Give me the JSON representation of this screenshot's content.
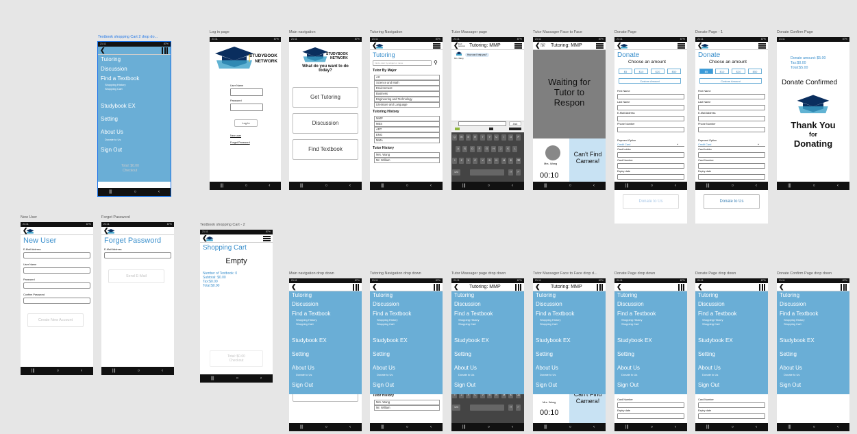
{
  "screens": {
    "cart2dd": {
      "label": "Textbook shopping Cart 2 drop do..."
    },
    "login": {
      "label": "Log in page",
      "brand1": "STUDYBOOK",
      "brand2": "NETWORK",
      "username_label": "User Name",
      "password_label": "Password",
      "login_btn": "Log In",
      "new_user": "New user",
      "forget_pw": "Forget Password"
    },
    "mainnav": {
      "label": "Main navigation",
      "question": "What do you want to do today?",
      "btn1": "Get Tutoring",
      "btn2": "Discussion",
      "btn3": "Find Textbook"
    },
    "tutnav": {
      "label": "Tutoring Navigation",
      "title": "Tutoring",
      "search_placeholder": "Find a tutor by subject or name",
      "major_header": "Tutor By Major",
      "majors": [
        "Art",
        "Science and Math",
        "Environment",
        "Business",
        "Engineering and Technology",
        "Literature and Language"
      ],
      "history_header": "Tutoring History",
      "history": [
        "MMP",
        "MES",
        "ART",
        "ENG",
        "MMA"
      ],
      "tutor_history_header": "Tutor History",
      "tutors": [
        "Mrs. Wang",
        "Mr. William"
      ]
    },
    "massager": {
      "label": "Tutor Massager page",
      "header_small1": "End",
      "header_small2": "session",
      "header_title": "Tutoring: MMP",
      "bubble": "How can I help you?",
      "ask": "Ask",
      "person": "Mrs. Wang"
    },
    "f2f": {
      "label": "Tutor Massager Face to Face",
      "header_title": "Tutoring: MMP",
      "waiting": "Waiting for Tutor to Respon",
      "camera": "Can't Find Camera!",
      "person": "Mrs. Wang",
      "timer": "00:10"
    },
    "donate": {
      "label": "Donate Page",
      "title": "Donate",
      "choose": "Choose an amount",
      "amounts": [
        "$5",
        "$10",
        "$20",
        "$50"
      ],
      "custom": "Custom Amount",
      "first": "First Name",
      "last": "Last Name",
      "email": "E-Mail Address",
      "phone": "Phone Number",
      "payment": "Payment Option",
      "credit": "Credit Card",
      "holder": "Card holder",
      "cardnum": "Card Number",
      "expiry": "Expiry date",
      "donate_btn": "Donate to Us"
    },
    "donate1": {
      "label": "Donate Page - 1"
    },
    "confirm": {
      "label": "Donate Confirm Page",
      "amount": "Donate amount: $5.00",
      "tax": "Tax:$0.00",
      "total": "Total:$5.00",
      "confirmed": "Donate Confirmed",
      "thank1": "Thank You",
      "thank2": "for",
      "thank3": "Donating"
    },
    "newuser": {
      "label": "New User",
      "title": "New User",
      "email": "E-Mail Address",
      "username": "User Name",
      "password": "Password",
      "confirm": "Confirm Password",
      "create": "Create New Account"
    },
    "forget": {
      "label": "Forget Password",
      "title": "Forget Password",
      "email": "E-Mail Address",
      "send": "Send E-Mail"
    },
    "cart2": {
      "label": "Textbook shopping Cart - 2",
      "title": "Shopping Cart",
      "empty": "Empty",
      "num": "Number of Textbook: 0",
      "subtotal": "Subtotal: $0.00",
      "tax": "Tax:$0.00",
      "total": "Total:$0.00",
      "checkout1": "Total: $0.00",
      "checkout2": "Checkout"
    },
    "mainnavdd": {
      "label": "Main navigation drop down"
    },
    "tutnavdd": {
      "label": "Tutoring Navigation  drop down"
    },
    "massagerdd": {
      "label": "Tutor Massager page drop down"
    },
    "f2fdd": {
      "label": "Tutor Massager Face to Face drop d..."
    },
    "donatedd": {
      "label": "Donate Page drop down"
    },
    "donatedd2": {
      "label": "Donate Page drop down"
    },
    "confirmdd": {
      "label": "Donate Confirm Page drop down"
    }
  },
  "menu": {
    "tutoring": "Tutoring",
    "discussion": "Discussion",
    "find": "Find a Textbook",
    "history": "Shopping History",
    "cart": "Shopping Cart",
    "studybook": "Studybook EX",
    "setting": "Setting",
    "about": "About Us",
    "donate": "Donate to Us",
    "signout": "Sign Out"
  },
  "status": {
    "time": "21:11",
    "battery": "87%"
  },
  "keyboard": {
    "row1": [
      "Q",
      "W",
      "E",
      "R",
      "T",
      "Y",
      "U",
      "I",
      "O",
      "P"
    ],
    "row2": [
      "A",
      "S",
      "D",
      "F",
      "G",
      "H",
      "J",
      "K",
      "L"
    ],
    "row3": [
      "⇧",
      "Z",
      "X",
      "C",
      "V",
      "B",
      "N",
      "M",
      "$",
      "⌫"
    ],
    "row4_left": "123",
    "row4_right": "!?"
  }
}
